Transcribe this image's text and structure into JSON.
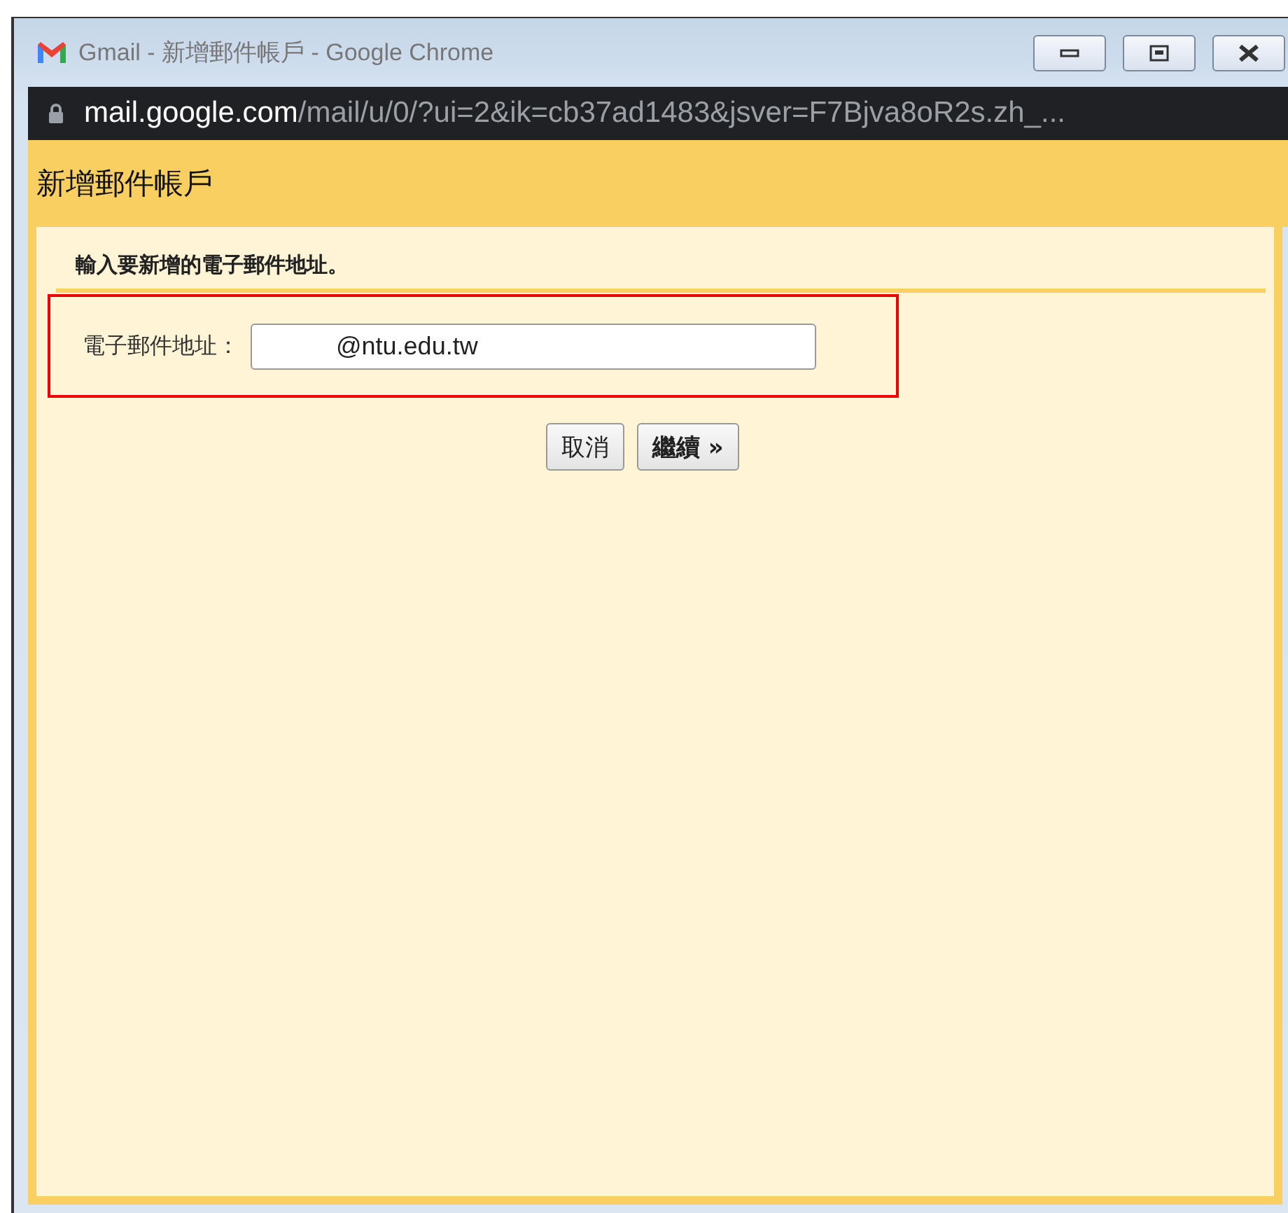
{
  "window": {
    "title": "Gmail - 新增郵件帳戶 - Google Chrome"
  },
  "address_bar": {
    "host": "mail.google.com",
    "path": "/mail/u/0/?ui=2&ik=cb37ad1483&jsver=F7Bjva8oR2s.zh_..."
  },
  "dialog": {
    "title": "新增郵件帳戶",
    "instruction": "輸入要新增的電子郵件地址。",
    "field": {
      "label": "電子郵件地址：",
      "value": "@ntu.edu.tw"
    },
    "buttons": [
      {
        "label": "取消",
        "kind": "cancel"
      },
      {
        "label": "繼續 »",
        "kind": "next"
      }
    ]
  }
}
